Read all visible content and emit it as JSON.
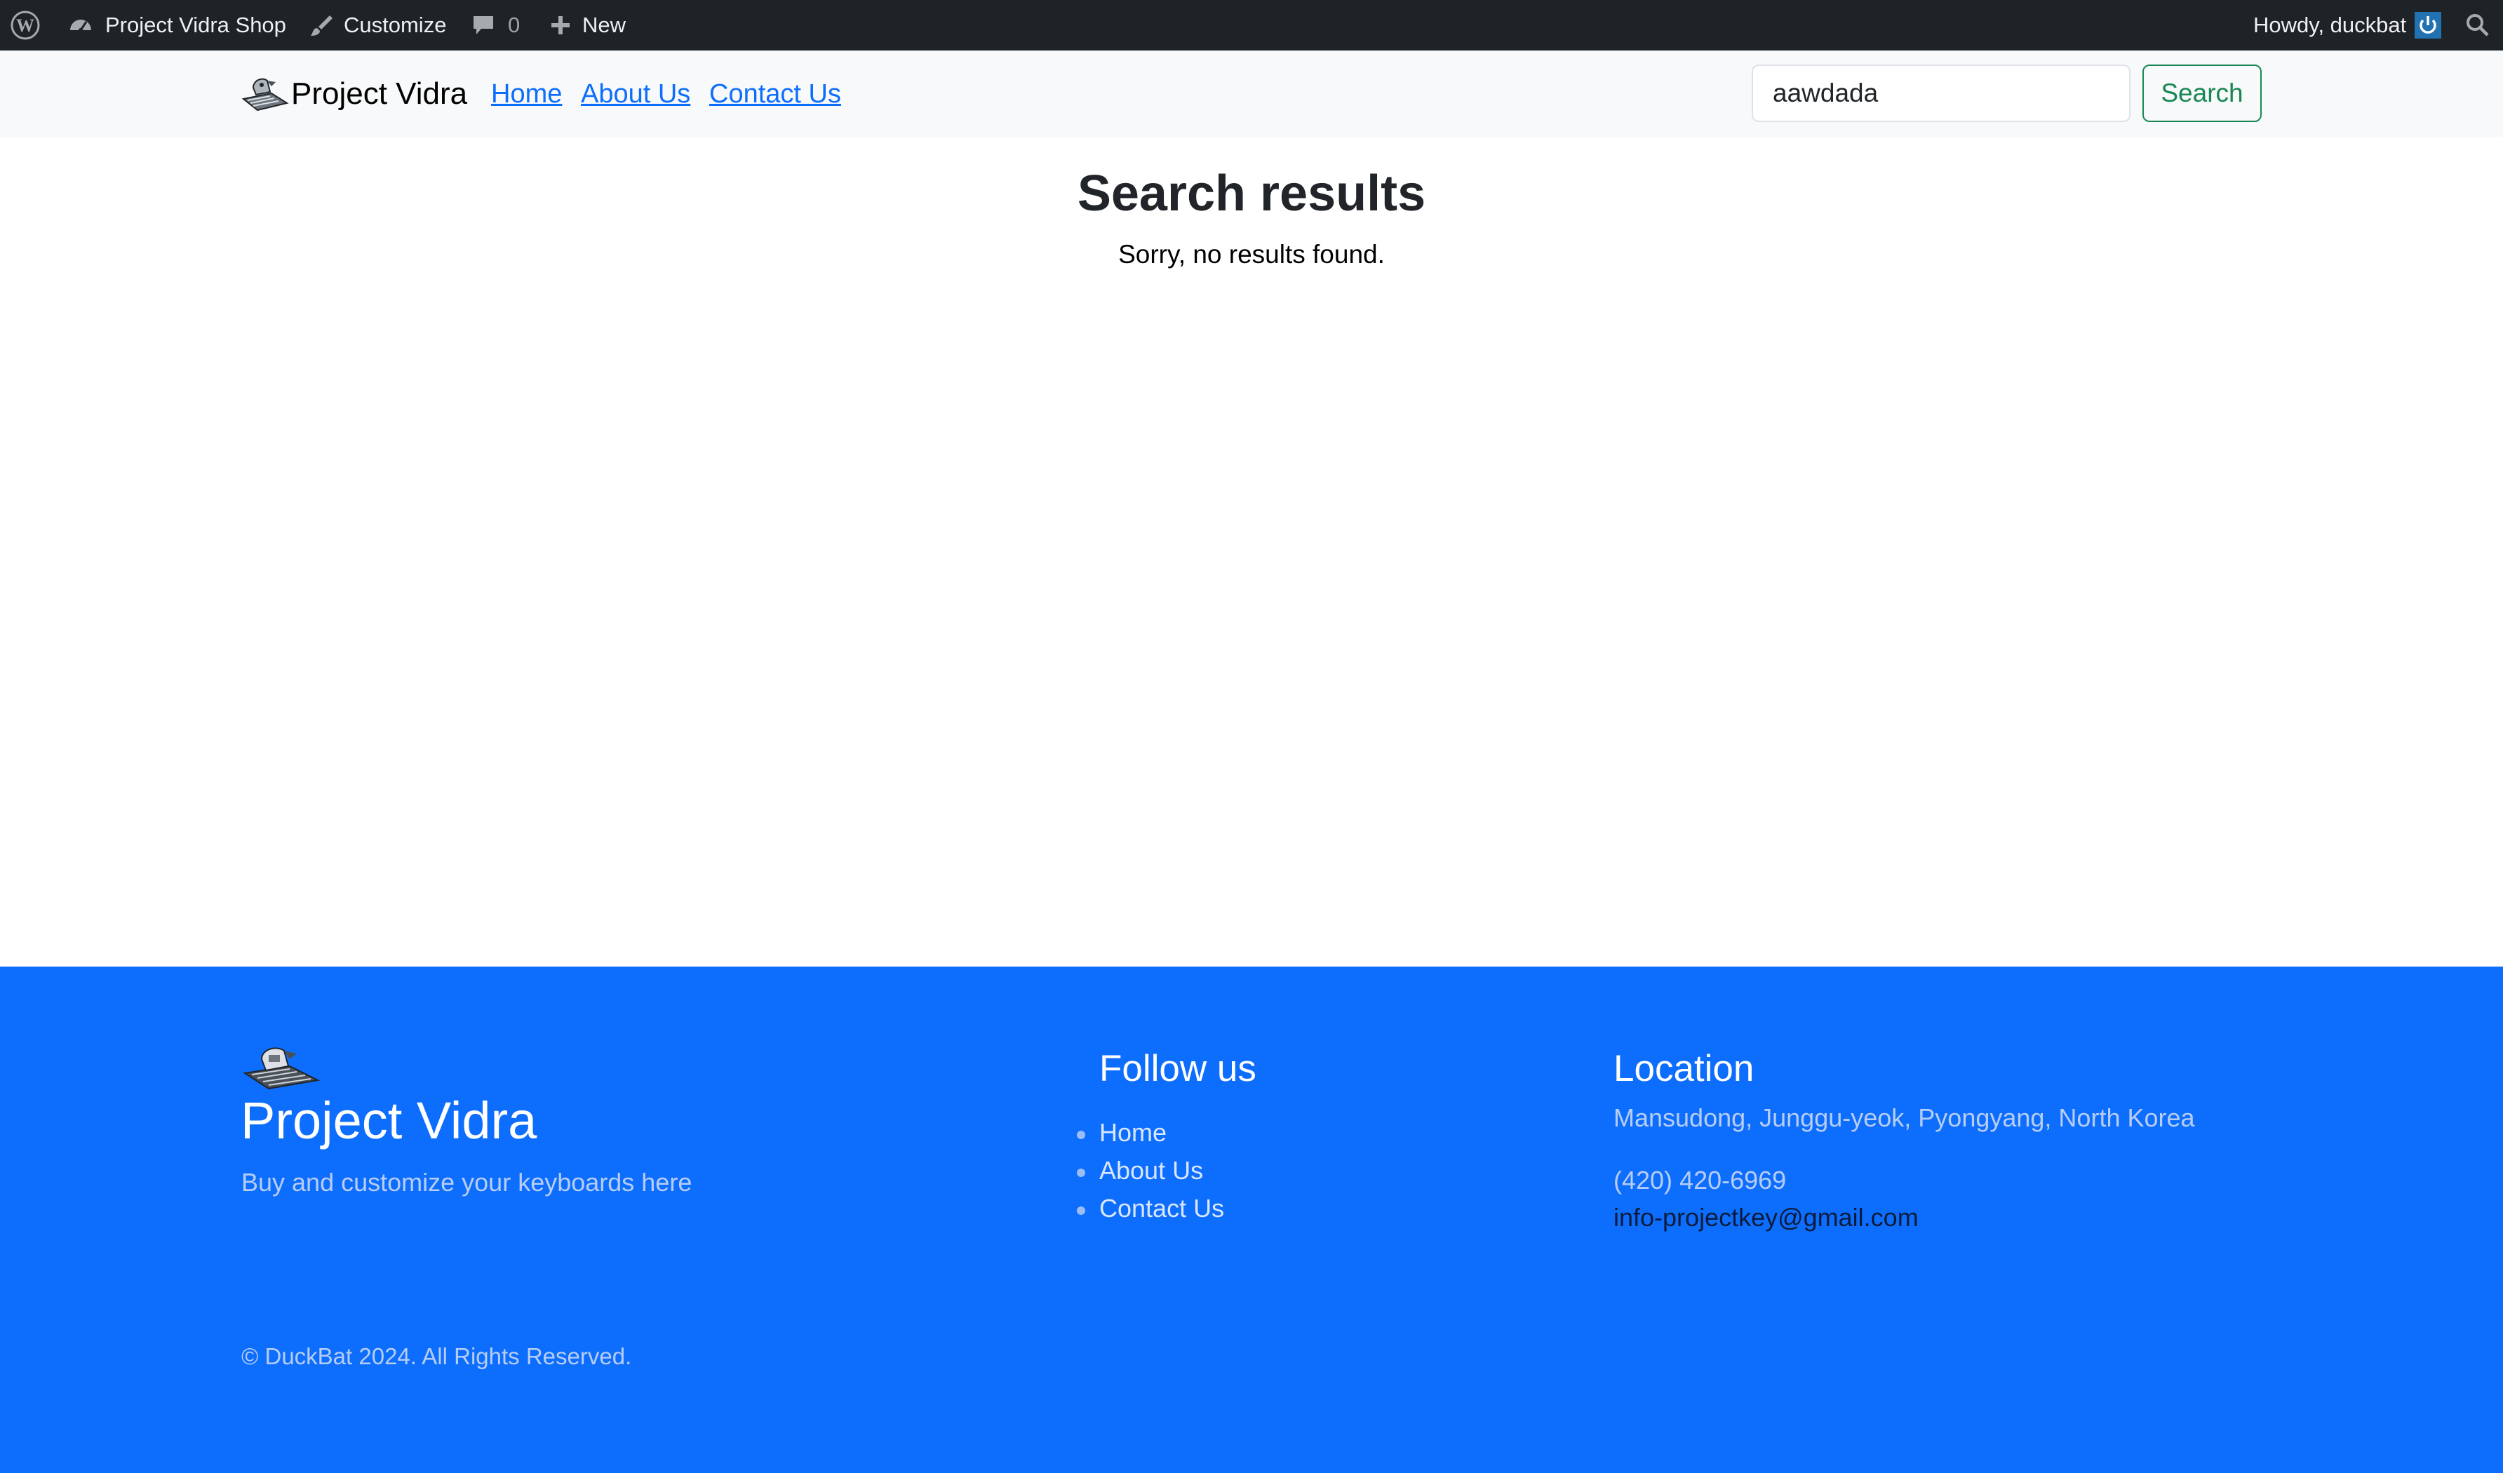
{
  "admin_bar": {
    "site_name": "Project Vidra Shop",
    "customize": "Customize",
    "comments_count": "0",
    "new": "New",
    "greeting": "Howdy, duckbat"
  },
  "header": {
    "brand": "Project Vidra",
    "nav": [
      "Home",
      "About Us",
      "Contact Us"
    ],
    "search": {
      "value": "aawdada",
      "button": "Search"
    }
  },
  "main": {
    "title": "Search results",
    "message": "Sorry, no results found."
  },
  "footer": {
    "brand": "Project Vidra",
    "tagline": "Buy and customize your keyboards here",
    "follow_heading": "Follow us",
    "follow_links": [
      "Home",
      "About Us",
      "Contact Us"
    ],
    "location_heading": "Location",
    "address": "Mansudong, Junggu-yeok, Pyongyang, North Korea",
    "phone": "(420) 420-6969",
    "email": "info-projectkey@gmail.com",
    "copyright": "© DuckBat 2024. All Rights Reserved."
  },
  "colors": {
    "admin_bar_bg": "#1d2327",
    "header_bg": "#f8f9fa",
    "link": "#0d6efd",
    "footer_bg": "#0d6efd",
    "search_button": "#198754"
  }
}
